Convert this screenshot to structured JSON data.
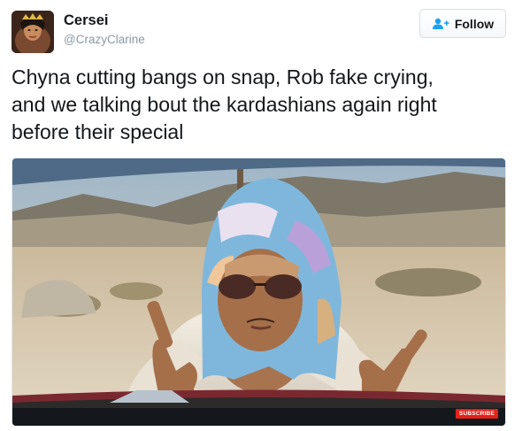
{
  "user": {
    "display_name": "Cersei",
    "handle": "@CrazyClarine"
  },
  "follow_button": {
    "label": "Follow",
    "icon": "add-user-icon"
  },
  "tweet": {
    "text_line1": "Chyna cutting bangs on snap, Rob fake crying,",
    "text_line2": "and we talking bout the kardashians again right",
    "text_line3": "before their special"
  },
  "media": {
    "subscribe_label": "SUBSCRIBE"
  },
  "colors": {
    "accent": "#1da1f2",
    "handle": "#8899a6",
    "subscribe_badge": "#e62117"
  }
}
